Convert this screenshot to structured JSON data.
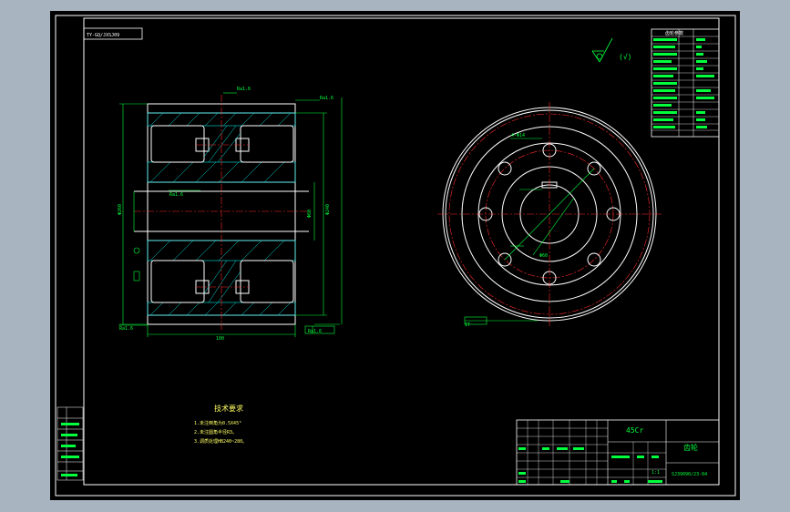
{
  "drawing": {
    "top_label": "TY-GQ/JXSJ09",
    "title_block": {
      "part_name": "齿轮",
      "material": "45Cr",
      "drawing_number": "SJ39090/23-04",
      "scale": "1:1"
    },
    "tech_requirements": {
      "title": "技术要求",
      "lines": [
        "1.未注倒角为0.5X45°",
        "2.未注圆角半径R3。",
        "3.调质处理HB240~280。"
      ]
    },
    "surface_note": "(√)",
    "section_dims": {
      "overall_width": "100",
      "bore": "Φ60",
      "outer": "Φ240",
      "tip": "Φ260"
    },
    "gear_params_header": "齿轮参数"
  },
  "colors": {
    "background": "#000000",
    "outline": "#ffffff",
    "dimension": "#00ff3c",
    "hatch": "#00e5e5",
    "centerline": "#ff2a2a",
    "app_chrome": "#a9b4c1"
  }
}
